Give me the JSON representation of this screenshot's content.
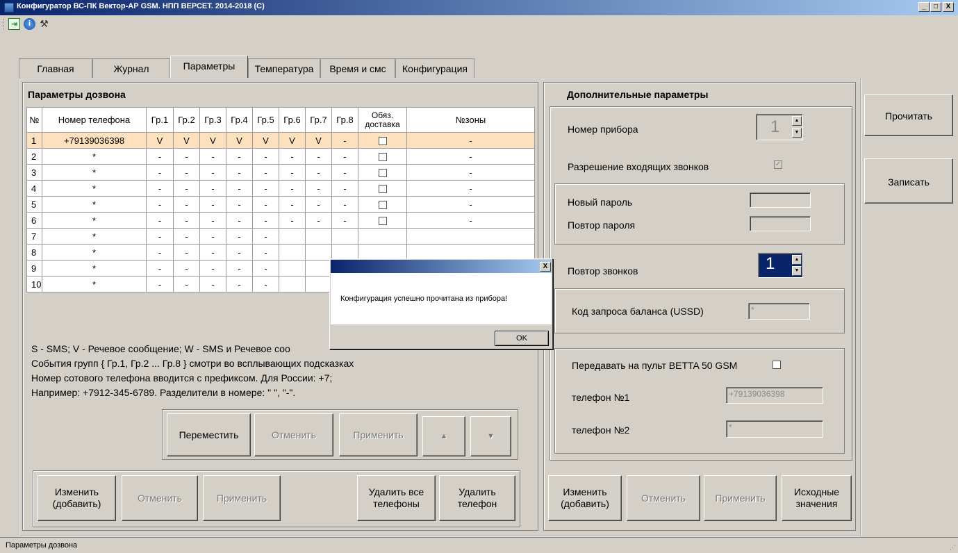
{
  "window": {
    "title": "Конфигуратор ВС-ПК Вектор-АР GSM. НПП ВЕРСЕТ. 2014-2018 (С)",
    "minimize": "_",
    "maximize": "□",
    "close": "X"
  },
  "toolbar": {
    "icons": [
      "exit-icon",
      "info-icon",
      "tools-icon"
    ]
  },
  "tabs": [
    {
      "label": "Главная"
    },
    {
      "label": "Журнал"
    },
    {
      "label": "Параметры",
      "active": true
    },
    {
      "label": "Температура"
    },
    {
      "label": "Время и смс"
    },
    {
      "label": "Конфигурация"
    }
  ],
  "dial": {
    "title": "Параметры дозвона",
    "columns": [
      "№",
      "Номер телефона",
      "Гр.1",
      "Гр.2",
      "Гр.3",
      "Гр.4",
      "Гр.5",
      "Гр.6",
      "Гр.7",
      "Гр.8",
      "Обяз. доставка",
      "№зоны"
    ],
    "rows": [
      {
        "n": "1",
        "phone": "+79139036398",
        "g": [
          "V",
          "V",
          "V",
          "V",
          "V",
          "V",
          "V",
          "-"
        ],
        "zone": "-"
      },
      {
        "n": "2",
        "phone": "*",
        "g": [
          "-",
          "-",
          "-",
          "-",
          "-",
          "-",
          "-",
          "-"
        ],
        "zone": "-"
      },
      {
        "n": "3",
        "phone": "*",
        "g": [
          "-",
          "-",
          "-",
          "-",
          "-",
          "-",
          "-",
          "-"
        ],
        "zone": "-"
      },
      {
        "n": "4",
        "phone": "*",
        "g": [
          "-",
          "-",
          "-",
          "-",
          "-",
          "-",
          "-",
          "-"
        ],
        "zone": "-"
      },
      {
        "n": "5",
        "phone": "*",
        "g": [
          "-",
          "-",
          "-",
          "-",
          "-",
          "-",
          "-",
          "-"
        ],
        "zone": "-"
      },
      {
        "n": "6",
        "phone": "*",
        "g": [
          "-",
          "-",
          "-",
          "-",
          "-",
          "-",
          "-",
          "-"
        ],
        "zone": "-"
      },
      {
        "n": "7",
        "phone": "*",
        "g": [
          "-",
          "-",
          "-",
          "-",
          "-"
        ],
        "zone": ""
      },
      {
        "n": "8",
        "phone": "*",
        "g": [
          "-",
          "-",
          "-",
          "-",
          "-"
        ],
        "zone": ""
      },
      {
        "n": "9",
        "phone": "*",
        "g": [
          "-",
          "-",
          "-",
          "-",
          "-"
        ],
        "zone": ""
      },
      {
        "n": "10",
        "phone": "*",
        "g": [
          "-",
          "-",
          "-",
          "-",
          "-"
        ],
        "zone": ""
      }
    ],
    "legend_line1": "S - SMS;  V - Речевое сообщение;  W - SMS и Речевое соо",
    "legend_line2": "События групп { Гр.1, Гр.2 ... Гр.8 } смотри во всплывающих подсказках",
    "legend_line3": "Номер сотового телефона вводится с префиксом. Для России: +7;",
    "legend_line4": "Например: +7912-345-6789. Разделители в номере: \" \", \"-\".",
    "move_btn": "Переместить",
    "cancel_btn": "Отменить",
    "apply_btn": "Применить",
    "up_icon": "▲",
    "down_icon": "▼",
    "edit_btn_l1": "Изменить",
    "edit_btn_l2": "(добавить)",
    "cancel2_btn": "Отменить",
    "apply2_btn": "Применить",
    "delete_all_l1": "Удалить все",
    "delete_all_l2": "телефоны",
    "delete_l1": "Удалить",
    "delete_l2": "телефон"
  },
  "extra": {
    "title": "Дополнительные параметры",
    "device_number_label": "Номер прибора",
    "device_number_value": "1",
    "incoming_calls_label": "Разрешение входящих звонков",
    "new_password_label": "Новый пароль",
    "repeat_password_label": "Повтор пароля",
    "call_repeat_label": "Повтор звонков",
    "call_repeat_value": "1",
    "ussd_label": "Код запроса баланса (USSD)",
    "ussd_value": "*",
    "betta_label": "Передавать на пульт BETTA 50 GSM",
    "phone1_label": "телефон №1",
    "phone1_value": "+79139036398",
    "phone2_label": "телефон №2",
    "phone2_value": "*",
    "edit_btn_l1": "Изменить",
    "edit_btn_l2": "(добавить)",
    "cancel_btn": "Отменить",
    "apply_btn": "Применить",
    "defaults_l1": "Исходные",
    "defaults_l2": "значения"
  },
  "side": {
    "read_btn": "Прочитать",
    "write_btn": "Записать"
  },
  "dialog": {
    "message": "Конфигурация успешно прочитана из прибора!",
    "ok": "OK",
    "close": "X"
  },
  "status": {
    "text": "Параметры дозвона"
  }
}
